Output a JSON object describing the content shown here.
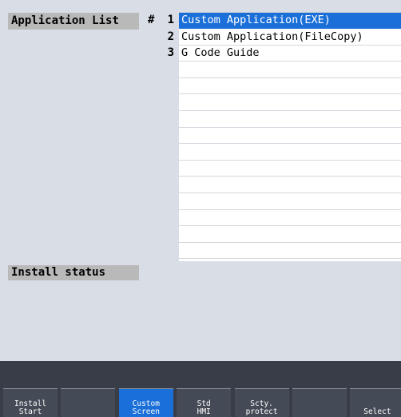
{
  "header": {
    "app_list_label": "Application List",
    "hash": "#"
  },
  "application_list": {
    "rows": [
      {
        "num": "1",
        "label": "Custom Application(EXE)",
        "selected": true
      },
      {
        "num": "2",
        "label": "Custom Application(FileCopy)",
        "selected": false
      },
      {
        "num": "3",
        "label": "G Code Guide",
        "selected": false
      },
      {
        "num": "",
        "label": "",
        "selected": false
      },
      {
        "num": "",
        "label": "",
        "selected": false
      },
      {
        "num": "",
        "label": "",
        "selected": false
      },
      {
        "num": "",
        "label": "",
        "selected": false
      },
      {
        "num": "",
        "label": "",
        "selected": false
      },
      {
        "num": "",
        "label": "",
        "selected": false
      },
      {
        "num": "",
        "label": "",
        "selected": false
      },
      {
        "num": "",
        "label": "",
        "selected": false
      },
      {
        "num": "",
        "label": "",
        "selected": false
      },
      {
        "num": "",
        "label": "",
        "selected": false
      },
      {
        "num": "",
        "label": "",
        "selected": false
      },
      {
        "num": "",
        "label": "",
        "selected": false
      }
    ]
  },
  "install_status": {
    "label": "Install status"
  },
  "softkeys": [
    {
      "line1": "Install",
      "line2": "Start",
      "active": false
    },
    {
      "line1": "",
      "line2": "",
      "active": false
    },
    {
      "line1": "Custom",
      "line2": "Screen",
      "active": true
    },
    {
      "line1": "Std",
      "line2": "HMI",
      "active": false
    },
    {
      "line1": "Scty.",
      "line2": "protect",
      "active": false
    },
    {
      "line1": "",
      "line2": "",
      "active": false
    },
    {
      "line1": "",
      "line2": "Select",
      "active": false
    }
  ],
  "colors": {
    "background": "#d8dde6",
    "selection": "#1a6fd9",
    "softkey_bar": "#454b56"
  }
}
